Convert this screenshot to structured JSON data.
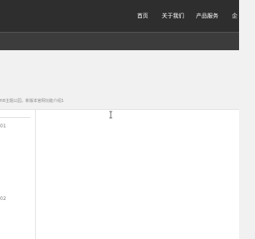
{
  "header": {
    "nav": [
      {
        "label": "首页"
      },
      {
        "label": "关于我们"
      },
      {
        "label": "产品服务"
      },
      {
        "label": "企"
      }
    ]
  },
  "intro": {
    "description": "ft8主题公园，新版本官网功能介绍1"
  },
  "sidebar": {
    "items": [
      {
        "label": "01"
      },
      {
        "label": "02"
      }
    ]
  },
  "colors": {
    "topbar": "#2e2e2e",
    "subbar": "#3c3c3c",
    "page_background": "#f1f1f1",
    "content_background": "#ffffff"
  },
  "icons": {
    "cursor": "text-cursor-icon"
  }
}
